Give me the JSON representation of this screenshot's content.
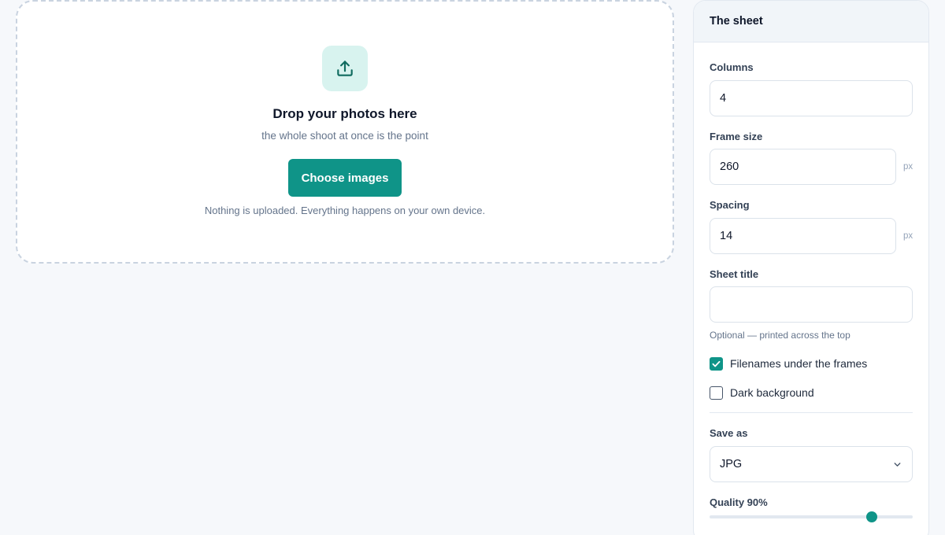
{
  "dropzone": {
    "icon": "upload-icon",
    "title": "Drop your photos here",
    "subtitle": "the whole shoot at once is the point",
    "choose_label": "Choose images",
    "privacy_note": "Nothing is uploaded. Everything happens on your own device."
  },
  "panel": {
    "title": "The sheet",
    "columns": {
      "label": "Columns",
      "value": "4"
    },
    "frame_size": {
      "label": "Frame size",
      "value": "260",
      "unit": "px"
    },
    "spacing": {
      "label": "Spacing",
      "value": "14",
      "unit": "px"
    },
    "sheet_title": {
      "label": "Sheet title",
      "value": "",
      "hint": "Optional — printed across the top"
    },
    "filenames": {
      "label": "Filenames under the frames",
      "checked": true
    },
    "dark_background": {
      "label": "Dark background",
      "checked": false
    },
    "save_as": {
      "label": "Save as",
      "value": "JPG",
      "icon": "chevron-down-icon"
    },
    "quality": {
      "label": "Quality 90%",
      "value": 90
    }
  },
  "colors": {
    "accent": "#0f9488",
    "accent_soft": "#d8f3ef",
    "background": "#f6f8fb"
  }
}
